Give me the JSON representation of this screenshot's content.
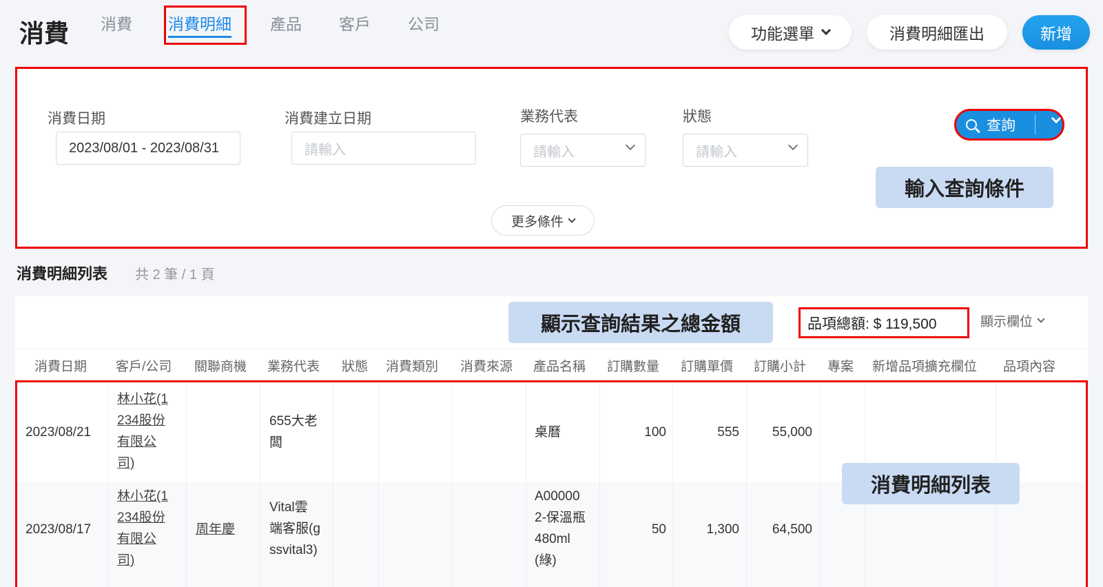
{
  "header": {
    "title": "消費",
    "tabs": [
      {
        "label": "消費"
      },
      {
        "label": "消費明細"
      },
      {
        "label": "產品"
      },
      {
        "label": "客戶"
      },
      {
        "label": "公司"
      }
    ],
    "function_menu": "功能選單",
    "export_label": "消費明細匯出",
    "add_label": "新增"
  },
  "filters": {
    "consume_date_label": "消費日期",
    "consume_date_value": "2023/08/01 - 2023/08/31",
    "created_date_label": "消費建立日期",
    "created_date_placeholder": "請輸入",
    "sales_rep_label": "業務代表",
    "sales_rep_placeholder": "請輸入",
    "status_label": "狀態",
    "status_placeholder": "請輸入",
    "search_label": "查詢",
    "more_label": "更多條件",
    "callout": "輸入查詢條件"
  },
  "list": {
    "title": "消費明細列表",
    "count": "共 2 筆 / 1 頁",
    "total_callout": "顯示查詢結果之總金額",
    "total_label": "品項總額: $ 119,500",
    "columns_label": "顯示欄位",
    "rows_callout": "消費明細列表",
    "headers": [
      "消費日期",
      "客戶/公司",
      "關聯商機",
      "業務代表",
      "狀態",
      "消費類別",
      "消費來源",
      "產品名稱",
      "訂購數量",
      "訂購單價",
      "訂購小計",
      "專案",
      "新增品項擴充欄位",
      "品項內容"
    ],
    "rows": [
      {
        "date": "2023/08/21",
        "customer": [
          "林小花(1",
          "234股份",
          "有限公",
          "司)"
        ],
        "opportunity": "",
        "sales_rep": [
          "655大老",
          "闆"
        ],
        "product": [
          "桌曆"
        ],
        "qty": "100",
        "price": "555",
        "subtotal": "55,000"
      },
      {
        "date": "2023/08/17",
        "customer": [
          "林小花(1",
          "234股份",
          "有限公",
          "司)"
        ],
        "opportunity": "周年慶",
        "sales_rep": [
          "Vital雲",
          "端客服(g",
          "ssvital3)"
        ],
        "product": [
          "A00000",
          "2-保溫瓶",
          "480ml",
          "(綠)"
        ],
        "qty": "50",
        "price": "1,300",
        "subtotal": "64,500"
      }
    ]
  },
  "colors": {
    "accent": "#1a8fe0",
    "highlight": "#e00000",
    "callout_bg": "#c9daf3"
  }
}
